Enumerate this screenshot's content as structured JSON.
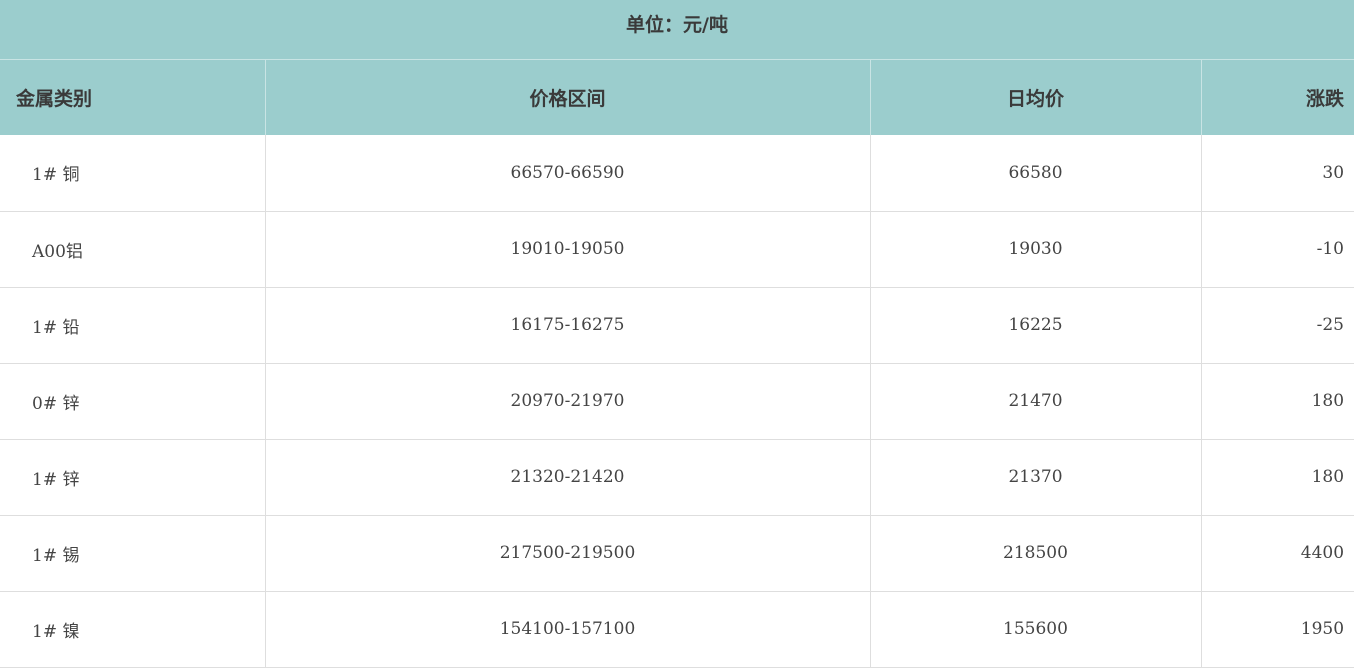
{
  "unit_label": "单位：元/吨",
  "columns": {
    "metal": "金属类别",
    "range": "价格区间",
    "avg": "日均价",
    "change": "涨跌"
  },
  "rows": [
    {
      "metal": "1# 铜",
      "range": "66570-66590",
      "avg": "66580",
      "change": "30"
    },
    {
      "metal": "A00铝",
      "range": "19010-19050",
      "avg": "19030",
      "change": "-10"
    },
    {
      "metal": "1# 铅",
      "range": "16175-16275",
      "avg": "16225",
      "change": "-25"
    },
    {
      "metal": "0# 锌",
      "range": "20970-21970",
      "avg": "21470",
      "change": "180"
    },
    {
      "metal": "1# 锌",
      "range": "21320-21420",
      "avg": "21370",
      "change": "180"
    },
    {
      "metal": "1# 锡",
      "range": "217500-219500",
      "avg": "218500",
      "change": "4400"
    },
    {
      "metal": "1# 镍",
      "range": "154100-157100",
      "avg": "155600",
      "change": "1950"
    }
  ],
  "colors": {
    "header_bg": "#9bcdcd",
    "border": "#dedede"
  }
}
